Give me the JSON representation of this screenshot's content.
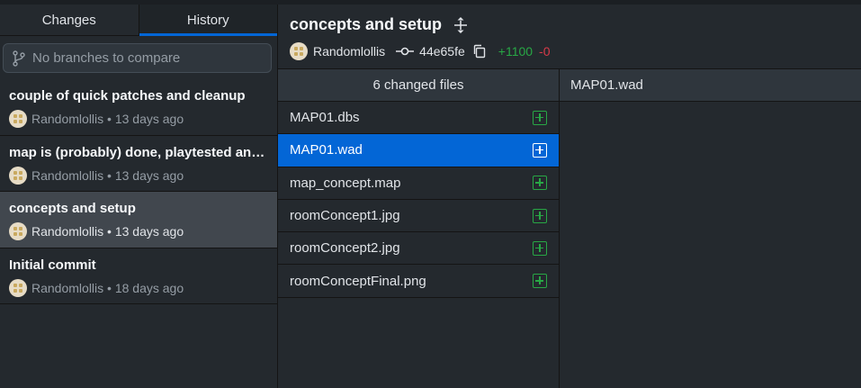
{
  "tabs": {
    "changes": "Changes",
    "history": "History"
  },
  "compare": {
    "placeholder": "No branches to compare",
    "icon": "branch-icon"
  },
  "commits": [
    {
      "title": "couple of quick patches and cleanup",
      "author": "Randomlollis",
      "time": "13 days ago"
    },
    {
      "title": "map is (probably) done, playtested and...",
      "author": "Randomlollis",
      "time": "13 days ago"
    },
    {
      "title": "concepts and setup",
      "author": "Randomlollis",
      "time": "13 days ago",
      "selected": true
    },
    {
      "title": "Initial commit",
      "author": "Randomlollis",
      "time": "18 days ago"
    }
  ],
  "header": {
    "title": "concepts and setup",
    "author": "Randomlollis",
    "sha": "44e65fe",
    "additions": "+1100",
    "deletions": "-0"
  },
  "files": {
    "count_label": "6 changed files",
    "items": [
      {
        "name": "MAP01.dbs",
        "status": "added"
      },
      {
        "name": "MAP01.wad",
        "status": "added",
        "selected": true
      },
      {
        "name": "map_concept.map",
        "status": "added"
      },
      {
        "name": "roomConcept1.jpg",
        "status": "added"
      },
      {
        "name": "roomConcept2.jpg",
        "status": "added"
      },
      {
        "name": "roomConceptFinal.png",
        "status": "added"
      }
    ]
  },
  "diff": {
    "filename": "MAP01.wad"
  },
  "colors": {
    "accent": "#0366d6",
    "added": "#28a745",
    "removed": "#d73a49",
    "background": "#24292e"
  }
}
